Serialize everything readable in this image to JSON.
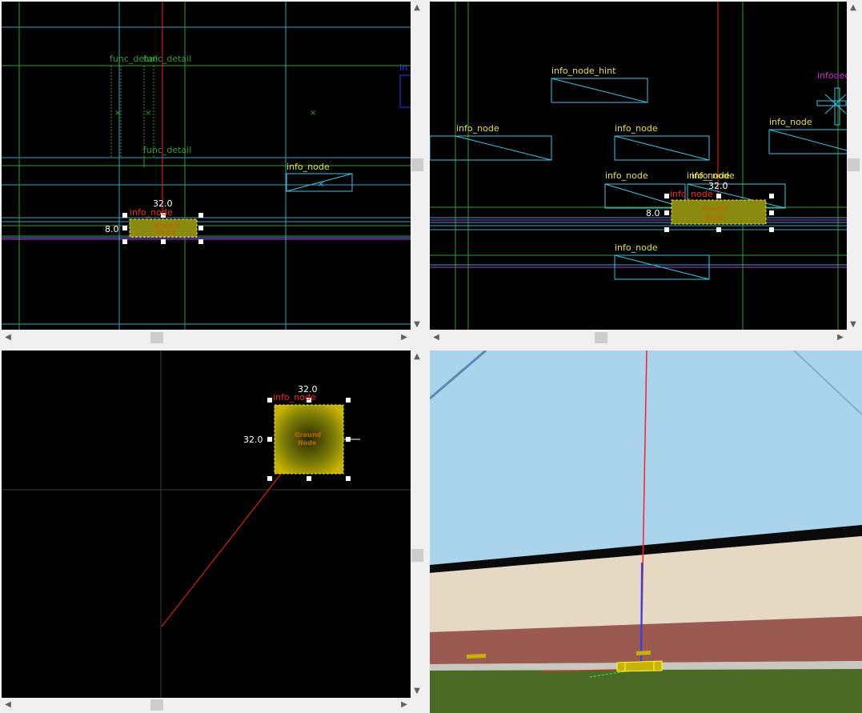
{
  "viewports": {
    "top_left": {
      "labels": {
        "func_detail_1": "func_detail",
        "func_detail_2": "func_detail",
        "func_detail_3": "func_detail",
        "info_node_red": "info_node",
        "info_node_right": "info_node",
        "info_fragment": "in"
      },
      "dims": {
        "width": "32.0",
        "height": "8.0"
      },
      "node_label_1": "Ground",
      "node_label_2": "Node"
    },
    "top_right": {
      "labels": {
        "hint": "info_node_hint",
        "infodecal": "infodec",
        "node_a": "info_node",
        "node_b": "info_node",
        "node_c": "info_node",
        "node_d": "info_node",
        "node_e": "info_node",
        "node_f": "info_node",
        "node_red": "info_node",
        "node_g": "info_node"
      },
      "dims": {
        "width": "32.0",
        "height": "8.0"
      },
      "node_label_1": "Ground",
      "node_label_2": "Node"
    },
    "bottom_left": {
      "labels": {
        "node_red": "info_node"
      },
      "dims": {
        "width": "32.0",
        "height": "32.0"
      },
      "node_label_1": "Ground",
      "node_label_2": "Node"
    },
    "camera_3d": {}
  },
  "colors": {
    "grid_cyan": "#33a7c4",
    "grid_green": "#2aa02a",
    "entity_yellow": "#e6e63c",
    "selected_red": "#ff2020",
    "node_fill": "#c8b400",
    "sky": "#a9d4ec",
    "wall": "#e6d9c4",
    "brick": "#9a5a50",
    "grass": "#4a6a26"
  },
  "icons": {
    "scroll_up": "▲",
    "scroll_down": "▼",
    "scroll_left": "◀",
    "scroll_right": "▶"
  }
}
